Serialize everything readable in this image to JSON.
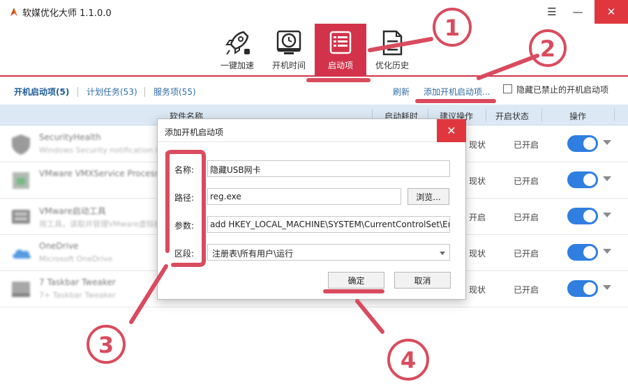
{
  "window": {
    "title": "软媒优化大师 1.1.0.0",
    "menu_icon": "☰",
    "minimize_icon": "—",
    "close_icon": "✕"
  },
  "toolbar": {
    "items": [
      {
        "label": "一键加速",
        "icon": "rocket-icon"
      },
      {
        "label": "开机时间",
        "icon": "clock-monitor-icon"
      },
      {
        "label": "启动项",
        "icon": "startup-list-icon",
        "active": true
      },
      {
        "label": "优化历史",
        "icon": "document-icon"
      }
    ]
  },
  "subtabs": {
    "tabs": [
      {
        "label": "开机启动项(5)",
        "active": true
      },
      {
        "label": "计划任务(53)"
      },
      {
        "label": "服务项(55)"
      }
    ],
    "refresh": "刷新",
    "add": "添加开机启动项...",
    "hide_disabled": "隐藏已禁止的开机启动项"
  },
  "table": {
    "headers": [
      "软件名称",
      "启动耗时",
      "建议操作",
      "开启状态",
      "操作"
    ],
    "rows": [
      {
        "name": "SecurityHealth",
        "desc": "Windows Security notification icon",
        "advice": "现状",
        "status": "已开启",
        "icon_color": "#7a7a7a"
      },
      {
        "name": "VMware VMXService Process",
        "desc": "",
        "advice": "现状",
        "status": "已开启",
        "icon_color": "#4aa25a"
      },
      {
        "name": "VMware启动工具",
        "desc": "用工具，读取并管理VMware虚拟机",
        "advice": "开启",
        "status": "已开启",
        "icon_color": "#666666"
      },
      {
        "name": "OneDrive",
        "desc": "Microsoft OneDrive",
        "advice": "现状",
        "status": "已开启",
        "icon_color": "#1f7ad6"
      },
      {
        "name": "7 Taskbar Tweaker",
        "desc": "7+ Taskbar Tweaker",
        "advice": "现状",
        "status": "已开启",
        "icon_color": "#8a8a8a"
      }
    ]
  },
  "dialog": {
    "title": "添加开机启动项",
    "close_icon": "✕",
    "fields": {
      "name": {
        "label": "名称:",
        "value": "隐藏USB网卡"
      },
      "path": {
        "label": "路径:",
        "value": "reg.exe",
        "browse": "浏览..."
      },
      "args": {
        "label": "参数:",
        "value": "add HKEY_LOCAL_MACHINE\\SYSTEM\\CurrentControlSet\\Er"
      },
      "section": {
        "label": "区段:",
        "value": "注册表\\所有用户\\运行"
      }
    },
    "ok": "确定",
    "cancel": "取消"
  },
  "annotations": [
    "①",
    "②",
    "③",
    "④"
  ],
  "colors": {
    "accent": "#d2334a",
    "link": "#2f6da6",
    "annotation": "#d94b5e",
    "toggle": "#2f7ee0",
    "close": "#e0373f"
  }
}
